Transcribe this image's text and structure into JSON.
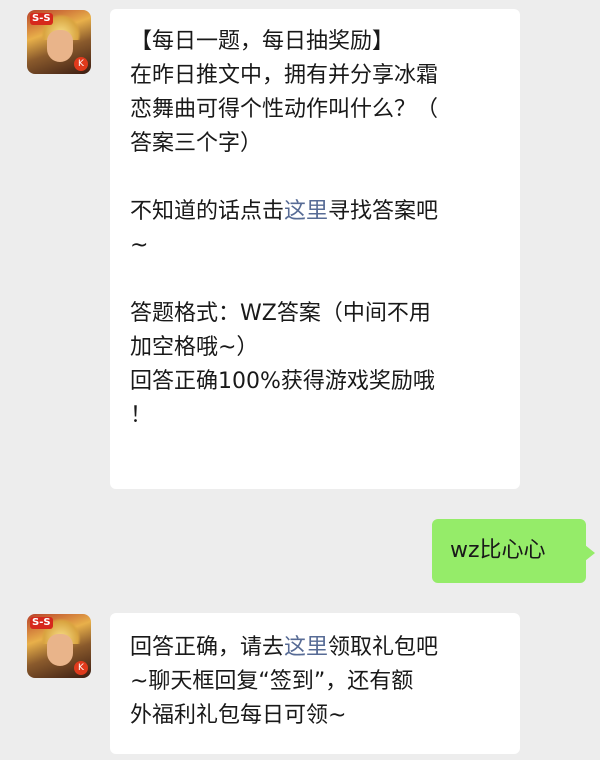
{
  "messages": [
    {
      "sender": "official",
      "avatar_icon": "game-hero-avatar-icon",
      "avatar_badge": "S-S",
      "avatar_corner": "K",
      "lines": [
        "【每日一题，每日抽奖励】",
        "在昨日推文中，拥有并分享冰霜",
        "恋舞曲可得个性动作叫什么？（",
        "答案三个字）",
        "",
        "不知道的话点击这里寻找答案吧",
        "~",
        "",
        "答题格式：WZ答案（中间不用",
        "加空格哦~）",
        "回答正确100%获得游戏奖励哦",
        "！"
      ],
      "link_line": {
        "before": "不知道的话点击",
        "link": "这里",
        "after": "寻找答案吧"
      }
    },
    {
      "sender": "user",
      "text": "wz比心心"
    },
    {
      "sender": "official",
      "avatar_icon": "game-hero-avatar-icon",
      "avatar_badge": "S-S",
      "avatar_corner": "K",
      "link_line": {
        "before": "回答正确，请去",
        "link": "这里",
        "after": "领取礼包吧"
      },
      "lines": [
        "~聊天框回复“签到”，还有额",
        "外福利礼包每日可领~"
      ]
    }
  ],
  "colors": {
    "background": "#ededed",
    "incoming_bubble": "#ffffff",
    "outgoing_bubble": "#95ec69",
    "link": "#576b95",
    "text": "#191919"
  }
}
